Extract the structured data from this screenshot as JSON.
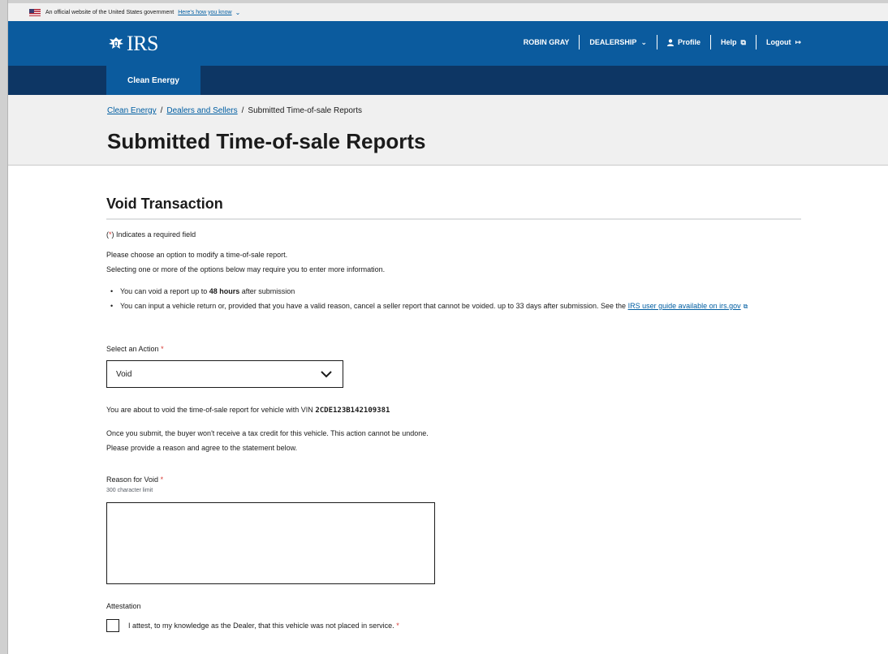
{
  "gov_banner": {
    "text": "An official website of the United States government",
    "link": "Here's how you know"
  },
  "header": {
    "logo_text": "IRS",
    "user_name": "ROBIN GRAY",
    "dealership_label": "DEALERSHIP",
    "profile_label": "Profile",
    "help_label": "Help",
    "logout_label": "Logout"
  },
  "subnav": {
    "tabs": [
      {
        "label": "Clean Energy",
        "active": true
      }
    ]
  },
  "breadcrumb": {
    "items": [
      "Clean Energy",
      "Dealers and Sellers",
      "Submitted Time-of-sale Reports"
    ]
  },
  "page_title": "Submitted Time-of-sale Reports",
  "form": {
    "section_title": "Void Transaction",
    "required_note_open": "(",
    "required_note_star": "*",
    "required_note_close": ") Indicates a required field",
    "intro_line1": "Please choose an option to modify a time-of-sale report.",
    "intro_line2": "Selecting one or more of the options below may require you to enter more information.",
    "bullet1_pre": "You can void a report up to ",
    "bullet1_bold": "48 hours",
    "bullet1_post": " after submission",
    "bullet2_text": "You can input a vehicle return or, provided that you have a valid reason, cancel a seller report that cannot be voided. up to 33 days after submission. See the ",
    "bullet2_link": "IRS user guide available on irs.gov",
    "action_label": "Select an Action",
    "required_star": "*",
    "action_value": "Void",
    "vin_msg_pre": "You are about to void the time-of-sale report for vehicle with VIN ",
    "vin": "2CDE123B142109381",
    "warning_line1": "Once you submit, the buyer won't receive a tax credit for this vehicle. This action cannot be undone.",
    "warning_line2": "Please provide a reason and agree to the statement below.",
    "reason_label": "Reason for Void",
    "reason_hint": "300 character limit",
    "reason_value": "",
    "attestation_label": "Attestation",
    "attestation_text": "I attest, to my knowledge as the Dealer, that this vehicle was not placed in service.",
    "attestation_checked": false
  },
  "colors": {
    "header_blue": "#0b5b9e",
    "subnav_navy": "#0d3664",
    "link_blue": "#005ea2",
    "required_red": "#d83933"
  },
  "icons": [
    "us-flag-icon",
    "irs-eagle-icon",
    "chevron-down-icon",
    "person-icon",
    "external-link-icon",
    "logout-icon"
  ]
}
